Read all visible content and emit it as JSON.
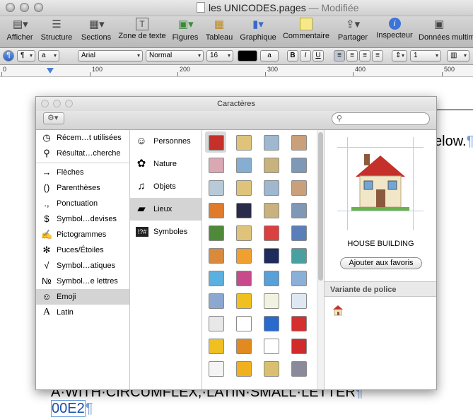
{
  "window": {
    "doc_title": "les UNICODES.pages",
    "separator": "—",
    "status": "Modifiée"
  },
  "toolbar": {
    "items": [
      {
        "label": "Afficher",
        "icon": "sidebar-icon"
      },
      {
        "label": "Structure",
        "icon": "outline-icon"
      },
      {
        "label": "Sections",
        "icon": "sections-icon"
      },
      {
        "label": "Zone de texte",
        "icon": "textbox-icon"
      },
      {
        "label": "Figures",
        "icon": "shapes-icon"
      },
      {
        "label": "Tableau",
        "icon": "table-icon"
      },
      {
        "label": "Graphique",
        "icon": "chart-icon"
      },
      {
        "label": "Commentaire",
        "icon": "comment-icon"
      },
      {
        "label": "Partager",
        "icon": "share-icon"
      },
      {
        "label": "Inspecteur",
        "icon": "inspector-icon"
      },
      {
        "label": "Données multim",
        "icon": "media-icon"
      }
    ]
  },
  "formatbar": {
    "paragraph_style": "¶",
    "char_style": "a",
    "font": "Arial",
    "typeface": "Normal",
    "size": "16",
    "bold": "B",
    "italic": "I",
    "underline": "U",
    "line_spacing": "1",
    "text_color_swatch": "a"
  },
  "ruler": {
    "labels": [
      "0",
      "100",
      "200",
      "300",
      "400",
      "500"
    ]
  },
  "document": {
    "line1": "elow.",
    "line2": "A·WITH·CIRCUMFLEX,·LATIN·SMALL·LETTER",
    "line3": "00E2",
    "pilcrow": "¶"
  },
  "palette": {
    "title": "Caractères",
    "search_placeholder": "",
    "categories": [
      {
        "label": "Récem…t utilisées",
        "icon": "clock-icon",
        "glyph": "◷"
      },
      {
        "label": "Résultat…cherche",
        "icon": "magnifier-icon",
        "glyph": "⚲"
      },
      {
        "label": "Flèches",
        "icon": "arrow-icon",
        "glyph": "→"
      },
      {
        "label": "Parenthèses",
        "icon": "parentheses-icon",
        "glyph": "()"
      },
      {
        "label": "Ponctuation",
        "icon": "punctuation-icon",
        "glyph": ".,"
      },
      {
        "label": "Symbol…devises",
        "icon": "currency-icon",
        "glyph": "$"
      },
      {
        "label": "Pictogrammes",
        "icon": "pictogram-icon",
        "glyph": "✍"
      },
      {
        "label": "Puces/Étoiles",
        "icon": "bullet-star-icon",
        "glyph": "✻"
      },
      {
        "label": "Symbol…atiques",
        "icon": "math-icon",
        "glyph": "√"
      },
      {
        "label": "Symbol…e lettres",
        "icon": "letterlike-icon",
        "glyph": "№"
      },
      {
        "label": "Emoji",
        "icon": "emoji-icon",
        "glyph": "☺"
      },
      {
        "label": "Latin",
        "icon": "latin-icon",
        "glyph": "A"
      }
    ],
    "subcategories": [
      {
        "label": "Personnes",
        "icon": "smiley-icon",
        "glyph": "☺"
      },
      {
        "label": "Nature",
        "icon": "flower-icon",
        "glyph": "✿"
      },
      {
        "label": "Objets",
        "icon": "bell-icon",
        "glyph": "🔔"
      },
      {
        "label": "Lieux",
        "icon": "car-icon",
        "glyph": "▰"
      },
      {
        "label": "Symboles",
        "icon": "symbols-icon",
        "glyph": "!?#"
      }
    ],
    "selected_char_name": "HOUSE BUILDING",
    "add_favorite": "Ajouter aux favoris",
    "variant_header": "Variante de police",
    "emoji_grid": [
      [
        "house",
        "office",
        "building",
        "school"
      ],
      [
        "hospital",
        "bank",
        "convenience",
        "hotel"
      ],
      [
        "department",
        "love-hotel",
        "church",
        "shop"
      ],
      [
        "sunset-city",
        "night-city",
        "castle",
        "european-castle"
      ],
      [
        "tent",
        "factory",
        "tokyo-tower",
        "mount-fuji"
      ],
      [
        "sunrise-mountain",
        "sunrise",
        "stars",
        "statue-liberty"
      ],
      [
        "rainbow",
        "ferris-wheel",
        "fountain",
        "roller-coaster"
      ],
      [
        "ship",
        "boat",
        "sailboat",
        "airplane"
      ],
      [
        "rocket",
        "bicycle",
        "car-blue",
        "car-red"
      ],
      [
        "taxi",
        "bus",
        "police-car",
        "fire-engine"
      ],
      [
        "ambulance",
        "truck",
        "train",
        "station"
      ]
    ]
  },
  "colors": {
    "selection": "#d4d4d4",
    "window_chrome": "#d0d0d0",
    "doc_link_blue": "#1a4fa8",
    "guide_blue": "#b9cfe8"
  }
}
